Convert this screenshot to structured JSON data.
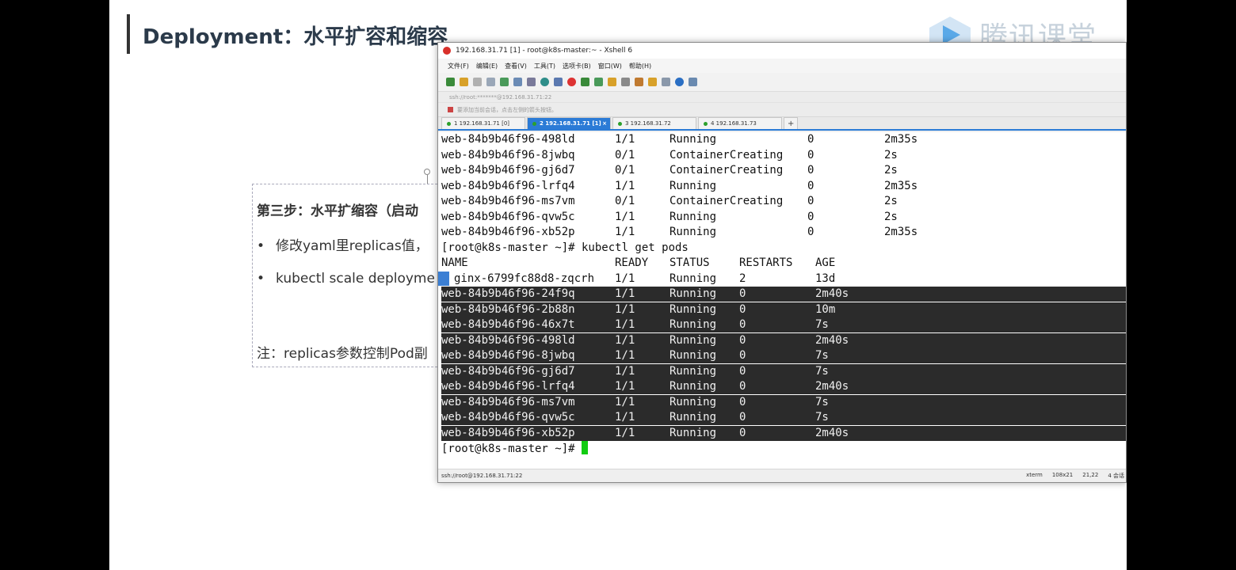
{
  "slide": {
    "title": "Deployment：水平扩容和缩容",
    "logo_text": "腾讯课堂",
    "step_title": "第三步：水平扩缩容（启动",
    "bullets": [
      "修改yaml里replicas值，",
      "kubectl scale deployme"
    ],
    "note": "注：replicas参数控制Pod副"
  },
  "xshell": {
    "window_title": "192.168.31.71 [1] - root@k8s-master:~ - Xshell 6",
    "menu": [
      "文件(F)",
      "编辑(E)",
      "查看(V)",
      "工具(T)",
      "选项卡(B)",
      "窗口(W)",
      "帮助(H)"
    ],
    "address": "ssh://root:*******@192.168.31.71:22",
    "hint": "要添加当前会话，点击左侧的箭头按钮。",
    "tabs": [
      {
        "label": "1 192.168.31.71 [0]",
        "active": false
      },
      {
        "label": "2 192.168.31.71 [1]",
        "active": true
      },
      {
        "label": "3 192.168.31.72",
        "active": false
      },
      {
        "label": "4 192.168.31.73",
        "active": false
      }
    ],
    "tab_add": "+",
    "tab_close": "×",
    "status": {
      "left": "ssh://root@192.168.31.71:22",
      "term": "xterm",
      "size": "108x21",
      "pos": "21,22",
      "sessions": "4 会话"
    },
    "icons": [
      "new-session-icon",
      "open-icon",
      "copy-icon",
      "paste-icon",
      "find-icon",
      "properties-icon",
      "globe-icon",
      "font-icon",
      "xshell-icon",
      "xftp-icon",
      "fullscreen-icon",
      "lock-icon",
      "keyboard-icon",
      "script-icon",
      "compose-icon",
      "layout-icon",
      "help-icon",
      "chat-icon"
    ]
  },
  "terminal": {
    "old_rows": [
      [
        "web-84b9b46f96-498ld",
        "1/1",
        "Running",
        "0",
        "2m35s"
      ],
      [
        "web-84b9b46f96-8jwbq",
        "0/1",
        "ContainerCreating",
        "0",
        "2s"
      ],
      [
        "web-84b9b46f96-gj6d7",
        "0/1",
        "ContainerCreating",
        "0",
        "2s"
      ],
      [
        "web-84b9b46f96-lrfq4",
        "1/1",
        "Running",
        "0",
        "2m35s"
      ],
      [
        "web-84b9b46f96-ms7vm",
        "0/1",
        "ContainerCreating",
        "0",
        "2s"
      ],
      [
        "web-84b9b46f96-qvw5c",
        "1/1",
        "Running",
        "0",
        "2s"
      ],
      [
        "web-84b9b46f96-xb52p",
        "1/1",
        "Running",
        "0",
        "2m35s"
      ]
    ],
    "command_line": "[root@k8s-master ~]# kubectl get pods",
    "headers": [
      "NAME",
      "READY",
      "STATUS",
      "RESTARTS",
      "AGE"
    ],
    "nginx_row": [
      "ginx-6799fc88d8-zqcrh",
      "1/1",
      "Running",
      "2",
      "13d"
    ],
    "rows": [
      [
        "web-84b9b46f96-24f9q",
        "1/1",
        "Running",
        "0",
        "2m40s"
      ],
      [
        "web-84b9b46f96-2b88n",
        "1/1",
        "Running",
        "0",
        "10m"
      ],
      [
        "web-84b9b46f96-46x7t",
        "1/1",
        "Running",
        "0",
        "7s"
      ],
      [
        "web-84b9b46f96-498ld",
        "1/1",
        "Running",
        "0",
        "2m40s"
      ],
      [
        "web-84b9b46f96-8jwbq",
        "1/1",
        "Running",
        "0",
        "7s"
      ],
      [
        "web-84b9b46f96-gj6d7",
        "1/1",
        "Running",
        "0",
        "7s"
      ],
      [
        "web-84b9b46f96-lrfq4",
        "1/1",
        "Running",
        "0",
        "2m40s"
      ],
      [
        "web-84b9b46f96-ms7vm",
        "1/1",
        "Running",
        "0",
        "7s"
      ],
      [
        "web-84b9b46f96-qvw5c",
        "1/1",
        "Running",
        "0",
        "7s"
      ],
      [
        "web-84b9b46f96-xb52p",
        "1/1",
        "Running",
        "0",
        "2m40s"
      ]
    ],
    "prompt": "[root@k8s-master ~]# "
  }
}
